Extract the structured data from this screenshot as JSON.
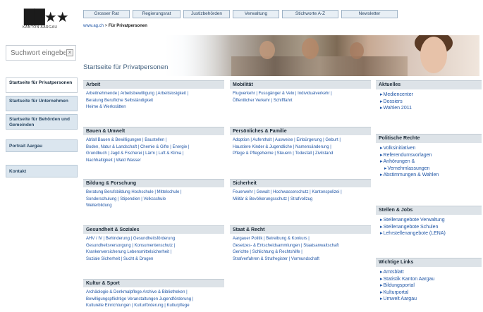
{
  "logo": {
    "mark": "██★★",
    "text": "KANTON AARGAU"
  },
  "search": {
    "placeholder": "Suchwort eingeben"
  },
  "left_nav": [
    "Startseite für Privatpersonen",
    "Startseite für Unternehmen",
    "Startseite für Behörden und Gemeinden",
    "Portrait Aargau",
    "Kontakt"
  ],
  "top_tabs": [
    "Grosser Rat",
    "Regierungsrat",
    "Justizbehörden",
    "Verwaltung",
    "Stichworte A-Z",
    "Newsletter"
  ],
  "breadcrumb": {
    "url": "www.ag.ch",
    "sep": " > ",
    "current": "Für Privatpersonen"
  },
  "page_title": "Startseite für Privatpersonen",
  "sections": {
    "arbeit": {
      "title": "Arbeit",
      "lines": [
        "Arbeitnehmende | Arbeitsbewilligung | Arbeitslosigkeit |",
        "Beratung  Berufliche Selbständigkeit",
        "Heime & Werkstätten"
      ]
    },
    "mobilitaet": {
      "title": "Mobilität",
      "lines": [
        "Flugverkehr | Fussgänger & Velo | Individualverkehr |",
        "Öffentlicher Verkehr | Schifffahrt"
      ]
    },
    "bauen": {
      "title": "Bauen & Umwelt",
      "lines": [
        "Abfall  Bauen & Bewilligungen | Baustellen |",
        "Boden, Natur & Landschaft | Chemie & Gifte | Energie |",
        "Grundbuch | Jagd & Fischerei | Lärm | Luft & Klima |",
        "Nachhaltigkeit | Wald  Wasser"
      ]
    },
    "persoenliches": {
      "title": "Persönliches & Familie",
      "lines": [
        "Adoption | Aufenthalt | Ausweise | Einbürgerung | Geburt |",
        "Haustiere  Kinder & Jugendliche | Namensänderung |",
        "Pflege & Pflegeheime | Steuern | Todesfall | Zivilstand"
      ]
    },
    "bildung": {
      "title": "Bildung & Forschung",
      "lines": [
        "Beratung  Berufsbildung  Hochschule | Mittelschule |",
        "Sonderschulung | Stipendien | Volksschule",
        "Weiterbildung"
      ]
    },
    "sicherheit": {
      "title": "Sicherheit",
      "lines": [
        "Feuerwehr | Gewalt | Hochwasserschutz | Kantonspolizei |",
        "Militär & Bevölkerungsschutz | Strafvollzug"
      ]
    },
    "gesundheit": {
      "title": "Gesundheit & Soziales",
      "lines": [
        "AHV / IV | Behinderung | Gesundheitsförderung",
        "Gesundheitsversorgung | Konsumentenschutz |",
        "Krankenversicherung  Lebensmittelsicherheit |",
        "Soziale Sicherheit | Sucht & Drogen"
      ]
    },
    "staat": {
      "title": "Staat & Recht",
      "lines": [
        "Aargauer Politik | Betreibung & Konkurs |",
        "Gesetzes- & Entscheidsammlungen | Staatsanwaltschaft",
        "Gerichte | Schlichtung & Rechtshilfe |",
        "Strafverfahren & Strafregister | Vormundschaft"
      ]
    },
    "kultur": {
      "title": "Kultur & Sport",
      "lines": [
        "Archäologie & Denkmalpflege  Archive & Bibliotheken |",
        "Bewilligungspflichtige Veranstaltungen  Jugendförderung |",
        "Kulturelle Einrichtungen | Kulturförderung | Kulturpflege"
      ]
    }
  },
  "aside": {
    "aktuelles": {
      "title": "Aktuelles",
      "items": [
        "Mediencenter",
        "Dossiers",
        "Wahlen 2011"
      ]
    },
    "politische": {
      "title": "Politische Rechte",
      "items": [
        "Volksinitiativen",
        "Referendumsvorlagen",
        "Anhörungen &",
        "Vernehmlassungen",
        "Abstimmungen & Wahlen"
      ]
    },
    "stellen": {
      "title": "Stellen & Jobs",
      "items": [
        "Stellenangebote Verwaltung",
        "Stellenangebote Schulen",
        "Lehrstellenangebote (LENA)"
      ]
    },
    "links": {
      "title": "Wichtige Links",
      "items": [
        "Amtsblatt",
        "Statistik Kanton Aargau",
        "Bildungsportal",
        "Kulturportal",
        "Umwelt Aargau"
      ]
    }
  }
}
